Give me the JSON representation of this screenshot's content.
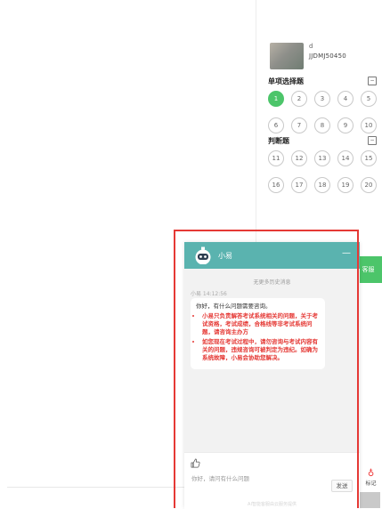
{
  "exam": {
    "user": {
      "name": "d",
      "id": "JJDMJ50450"
    },
    "single_choice": {
      "title": "单项选择题",
      "collapse_icon": "minus-square-icon",
      "questions": [
        "1",
        "2",
        "3",
        "4",
        "5",
        "6",
        "7",
        "8",
        "9",
        "10"
      ],
      "answered": [
        "1"
      ]
    },
    "true_false": {
      "title": "判断题",
      "collapse_icon": "minus-square-icon",
      "questions": [
        "11",
        "12",
        "13",
        "14",
        "15",
        "16",
        "17",
        "18",
        "19",
        "20"
      ]
    },
    "service_tab_label": "客服",
    "bookmark_label": "标记"
  },
  "chat": {
    "title": "小易",
    "minimize_icon": "minus-icon",
    "no_history": "无更多历史消息",
    "msg_meta": "小易 14:12:56",
    "greeting": "你好，有什么问题需要咨询。",
    "notices": [
      "小易只负责解答考试系统相关的问题，关于考试资格，考试成绩，合格线等非考试系统问题，请咨询主办方",
      "如您现在考试过程中，请勿咨询与考试内容有关的问题，违规咨询可被判定为违纪。如确为系统故障，小易会协助您解决。"
    ],
    "input_placeholder": "你好，请问有什么问题",
    "send_label": "发送",
    "footer_note": "AI智能客服由云服务提供"
  },
  "colors": {
    "accent": "#5ab3af",
    "active": "#4cc56a",
    "alert": "#e53935"
  }
}
